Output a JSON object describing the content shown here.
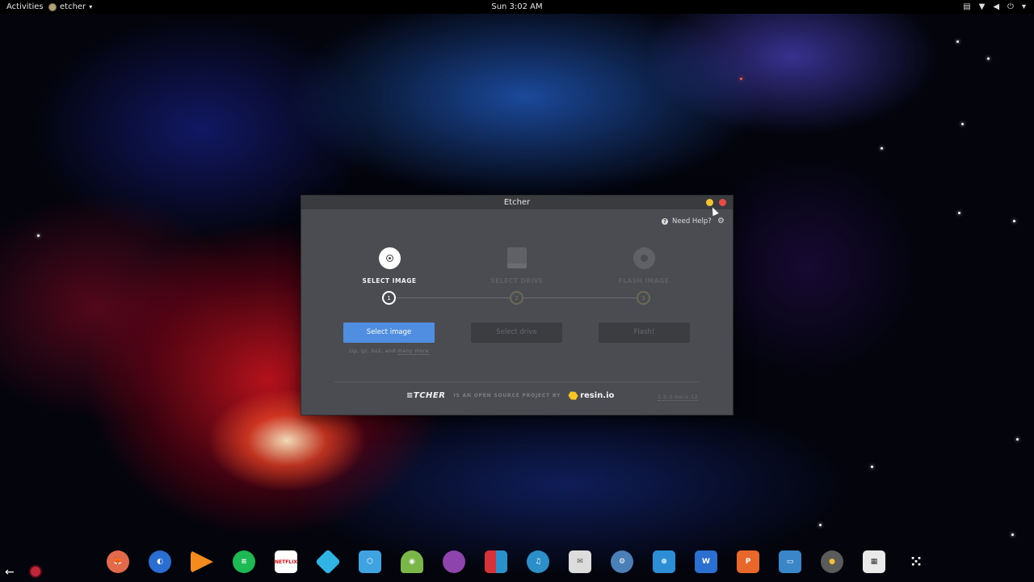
{
  "topbar": {
    "activities": "Activities",
    "app_name": "etcher",
    "clock": "Sun  3:02 AM"
  },
  "window": {
    "title": "Etcher",
    "help_label": "Need Help?",
    "steps": [
      {
        "label": "SELECT IMAGE",
        "number": "1",
        "state": "active"
      },
      {
        "label": "SELECT DRIVE",
        "number": "2",
        "state": "disabled"
      },
      {
        "label": "FLASH IMAGE",
        "number": "3",
        "state": "disabled"
      }
    ],
    "buttons": {
      "select_image": "Select image",
      "select_drive": "Select drive",
      "flash": "Flash!"
    },
    "formats_prefix": "zip, gz, bz2, and ",
    "formats_more": "many more",
    "footer": {
      "brand": "≡TCHER",
      "tagline": "IS AN OPEN SOURCE PROJECT BY",
      "company": "resin.io",
      "version": "1.0.0-beta.12"
    }
  },
  "dock": {
    "apps": [
      {
        "name": "firefox",
        "icon": "fox-icon",
        "color": "#e26a4a"
      },
      {
        "name": "browser",
        "icon": "globe-icon",
        "color": "#2a6ed1"
      },
      {
        "name": "google-play-music",
        "icon": "play-music-icon",
        "color": "#f58a1f"
      },
      {
        "name": "spotify",
        "icon": "spotify-icon",
        "color": "#1db954"
      },
      {
        "name": "netflix",
        "icon": "netflix-icon",
        "color": "#ffffff"
      },
      {
        "name": "kodi",
        "icon": "kodi-icon",
        "color": "#2fb4e3"
      },
      {
        "name": "box",
        "icon": "cube-icon",
        "color": "#3ea3e0"
      },
      {
        "name": "android-studio",
        "icon": "android-icon",
        "color": "#7ab648"
      },
      {
        "name": "music",
        "icon": "orb-icon",
        "color": "#8e44ad"
      },
      {
        "name": "tiles",
        "icon": "tiles-icon",
        "color": "#d6323a"
      },
      {
        "name": "headphones",
        "icon": "headphones-icon",
        "color": "#2b90c9"
      },
      {
        "name": "mail",
        "icon": "mail-icon",
        "color": "#dcdcdc"
      },
      {
        "name": "steam",
        "icon": "steam-icon",
        "color": "#4a7fb8"
      },
      {
        "name": "software",
        "icon": "bag-icon",
        "color": "#2c8fd6"
      },
      {
        "name": "word",
        "icon": "word-icon",
        "color": "#2b6fd1"
      },
      {
        "name": "powerpoint",
        "icon": "powerpoint-icon",
        "color": "#e8672a"
      },
      {
        "name": "files",
        "icon": "folder-icon",
        "color": "#3a86c8"
      },
      {
        "name": "disk",
        "icon": "disk-icon",
        "color": "#5b5b5b"
      },
      {
        "name": "workspaces",
        "icon": "grid-icon",
        "color": "#e9e9e9"
      },
      {
        "name": "show-apps",
        "icon": "apps-icon",
        "color": "#ffffff"
      }
    ]
  }
}
